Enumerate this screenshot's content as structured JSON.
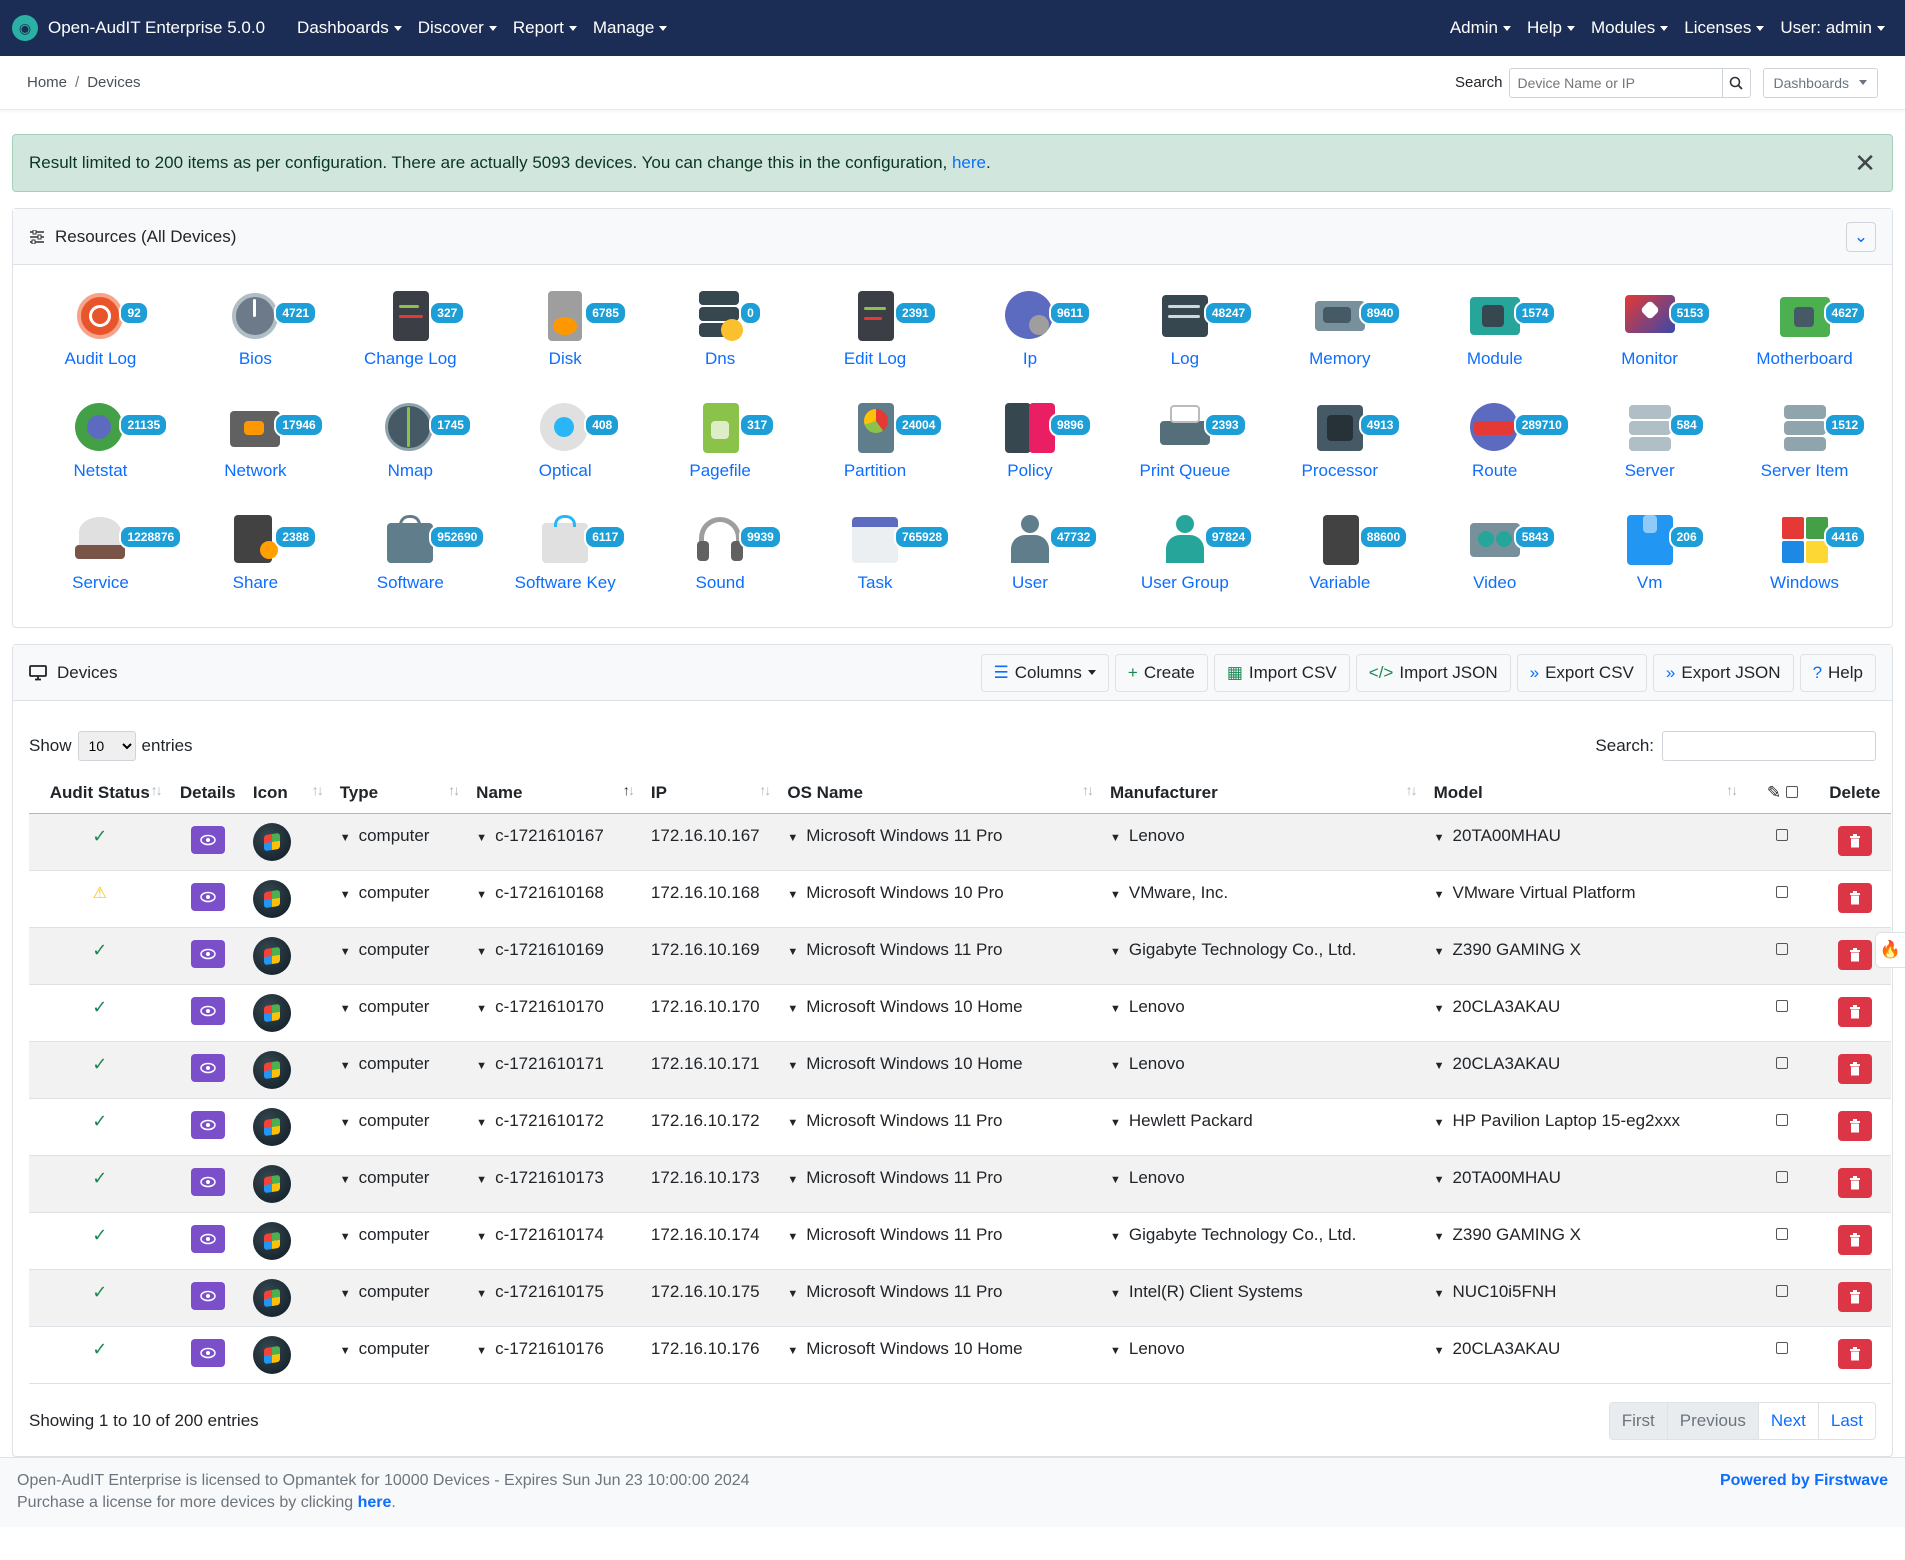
{
  "nav": {
    "brand": "Open-AudIT Enterprise 5.0.0",
    "left": [
      "Dashboards",
      "Discover",
      "Report",
      "Manage"
    ],
    "right": [
      "Admin",
      "Help",
      "Modules",
      "Licenses",
      "User: admin"
    ]
  },
  "breadcrumb": {
    "home": "Home",
    "current": "Devices"
  },
  "search": {
    "label": "Search",
    "placeholder": "Device Name or IP",
    "dashboards": "Dashboards"
  },
  "alert": {
    "text": "Result limited to 200 items as per configuration. There are actually 5093 devices. You can change this in the configuration, ",
    "link": "here",
    "end": "."
  },
  "resources": {
    "title": "Resources (All Devices)",
    "items": [
      {
        "label": "Audit Log",
        "count": "92",
        "icon": "audit-log-icon"
      },
      {
        "label": "Bios",
        "count": "4721",
        "icon": "bios-icon"
      },
      {
        "label": "Change Log",
        "count": "327",
        "icon": "change-log-icon"
      },
      {
        "label": "Disk",
        "count": "6785",
        "icon": "disk-icon"
      },
      {
        "label": "Dns",
        "count": "0",
        "icon": "dns-icon"
      },
      {
        "label": "Edit Log",
        "count": "2391",
        "icon": "edit-log-icon"
      },
      {
        "label": "Ip",
        "count": "9611",
        "icon": "ip-icon"
      },
      {
        "label": "Log",
        "count": "48247",
        "icon": "log-icon"
      },
      {
        "label": "Memory",
        "count": "8940",
        "icon": "memory-icon"
      },
      {
        "label": "Module",
        "count": "1574",
        "icon": "module-icon"
      },
      {
        "label": "Monitor",
        "count": "5153",
        "icon": "monitor-icon"
      },
      {
        "label": "Motherboard",
        "count": "4627",
        "icon": "motherboard-icon"
      },
      {
        "label": "Netstat",
        "count": "21135",
        "icon": "netstat-icon"
      },
      {
        "label": "Network",
        "count": "17946",
        "icon": "network-icon"
      },
      {
        "label": "Nmap",
        "count": "1745",
        "icon": "nmap-icon"
      },
      {
        "label": "Optical",
        "count": "408",
        "icon": "optical-icon"
      },
      {
        "label": "Pagefile",
        "count": "317",
        "icon": "pagefile-icon"
      },
      {
        "label": "Partition",
        "count": "24004",
        "icon": "partition-icon"
      },
      {
        "label": "Policy",
        "count": "9896",
        "icon": "policy-icon"
      },
      {
        "label": "Print Queue",
        "count": "2393",
        "icon": "print-queue-icon"
      },
      {
        "label": "Processor",
        "count": "4913",
        "icon": "processor-icon"
      },
      {
        "label": "Route",
        "count": "289710",
        "icon": "route-icon"
      },
      {
        "label": "Server",
        "count": "584",
        "icon": "server-icon"
      },
      {
        "label": "Server Item",
        "count": "1512",
        "icon": "server-item-icon"
      },
      {
        "label": "Service",
        "count": "1228876",
        "icon": "service-icon"
      },
      {
        "label": "Share",
        "count": "2388",
        "icon": "share-icon"
      },
      {
        "label": "Software",
        "count": "952690",
        "icon": "software-icon"
      },
      {
        "label": "Software Key",
        "count": "6117",
        "icon": "software-key-icon"
      },
      {
        "label": "Sound",
        "count": "9939",
        "icon": "sound-icon"
      },
      {
        "label": "Task",
        "count": "765928",
        "icon": "task-icon"
      },
      {
        "label": "User",
        "count": "47732",
        "icon": "user-icon"
      },
      {
        "label": "User Group",
        "count": "97824",
        "icon": "user-group-icon"
      },
      {
        "label": "Variable",
        "count": "88600",
        "icon": "variable-icon"
      },
      {
        "label": "Video",
        "count": "5843",
        "icon": "video-icon"
      },
      {
        "label": "Vm",
        "count": "206",
        "icon": "vm-icon"
      },
      {
        "label": "Windows",
        "count": "4416",
        "icon": "windows-icon"
      }
    ]
  },
  "devices": {
    "title": "Devices",
    "buttons": [
      "Columns",
      "Create",
      "Import CSV",
      "Import JSON",
      "Export CSV",
      "Export JSON",
      "Help"
    ],
    "show": "Show",
    "entries_value": "10",
    "entries": "entries",
    "search_label": "Search:",
    "columns": [
      "Audit Status",
      "Details",
      "Icon",
      "Type",
      "Name",
      "IP",
      "OS Name",
      "Manufacturer",
      "Model",
      "",
      "Delete"
    ],
    "rows": [
      {
        "status": "ok",
        "type": "computer",
        "name": "c-1721610167",
        "ip": "172.16.10.167",
        "os": "Microsoft Windows 11 Pro",
        "manufacturer": "Lenovo",
        "model": "20TA00MHAU"
      },
      {
        "status": "warn",
        "type": "computer",
        "name": "c-1721610168",
        "ip": "172.16.10.168",
        "os": "Microsoft Windows 10 Pro",
        "manufacturer": "VMware, Inc.",
        "model": "VMware Virtual Platform"
      },
      {
        "status": "ok",
        "type": "computer",
        "name": "c-1721610169",
        "ip": "172.16.10.169",
        "os": "Microsoft Windows 11 Pro",
        "manufacturer": "Gigabyte Technology Co., Ltd.",
        "model": "Z390 GAMING X"
      },
      {
        "status": "ok",
        "type": "computer",
        "name": "c-1721610170",
        "ip": "172.16.10.170",
        "os": "Microsoft Windows 10 Home",
        "manufacturer": "Lenovo",
        "model": "20CLA3AKAU"
      },
      {
        "status": "ok",
        "type": "computer",
        "name": "c-1721610171",
        "ip": "172.16.10.171",
        "os": "Microsoft Windows 10 Home",
        "manufacturer": "Lenovo",
        "model": "20CLA3AKAU"
      },
      {
        "status": "ok",
        "type": "computer",
        "name": "c-1721610172",
        "ip": "172.16.10.172",
        "os": "Microsoft Windows 11 Pro",
        "manufacturer": "Hewlett Packard",
        "model": "HP Pavilion Laptop 15-eg2xxx"
      },
      {
        "status": "ok",
        "type": "computer",
        "name": "c-1721610173",
        "ip": "172.16.10.173",
        "os": "Microsoft Windows 11 Pro",
        "manufacturer": "Lenovo",
        "model": "20TA00MHAU"
      },
      {
        "status": "ok",
        "type": "computer",
        "name": "c-1721610174",
        "ip": "172.16.10.174",
        "os": "Microsoft Windows 11 Pro",
        "manufacturer": "Gigabyte Technology Co., Ltd.",
        "model": "Z390 GAMING X"
      },
      {
        "status": "ok",
        "type": "computer",
        "name": "c-1721610175",
        "ip": "172.16.10.175",
        "os": "Microsoft Windows 11 Pro",
        "manufacturer": "Intel(R) Client Systems",
        "model": "NUC10i5FNH"
      },
      {
        "status": "ok",
        "type": "computer",
        "name": "c-1721610176",
        "ip": "172.16.10.176",
        "os": "Microsoft Windows 10 Home",
        "manufacturer": "Lenovo",
        "model": "20CLA3AKAU"
      }
    ],
    "info": "Showing 1 to 10 of 200 entries",
    "pager": [
      "First",
      "Previous",
      "Next",
      "Last"
    ]
  },
  "footer": {
    "line1": "Open-AudIT Enterprise is licensed to Opmantek for 10000 Devices - Expires Sun Jun 23 10:00:00 2024",
    "line2": "Purchase a license for more devices by clicking ",
    "link": "here",
    "end": ".",
    "powered": "Powered by Firstwave"
  },
  "colors": {
    "navbar": "#1b2c55",
    "badge": "#1d9ed6",
    "details": "#7b4fc9",
    "delete": "#dc3545",
    "ok": "#198754",
    "warn": "#ffc107"
  }
}
